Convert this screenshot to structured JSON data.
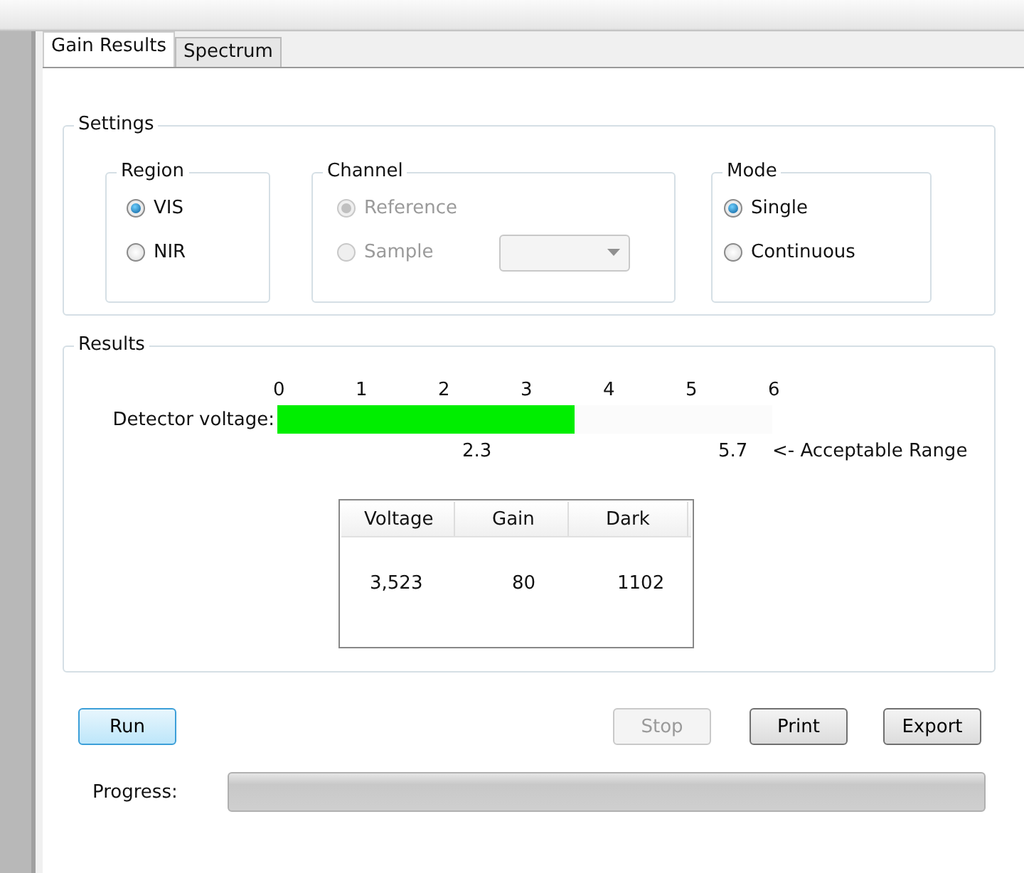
{
  "tabs": [
    {
      "label": "Gain Results",
      "selected": true
    },
    {
      "label": "Spectrum",
      "selected": false
    }
  ],
  "settings": {
    "title": "Settings",
    "groups": [
      {
        "title": "Region",
        "kind": "radios",
        "options": [
          {
            "label": "VIS",
            "selected": true,
            "disabled": false
          },
          {
            "label": "NIR",
            "selected": false,
            "disabled": false
          }
        ]
      },
      {
        "title": "Channel",
        "kind": "radios-combo",
        "options": [
          {
            "label": "Reference",
            "selected": true,
            "disabled": true
          },
          {
            "label": "Sample",
            "selected": false,
            "disabled": true
          }
        ],
        "combo": {
          "disabled": true
        }
      },
      {
        "title": "Mode",
        "kind": "radios",
        "options": [
          {
            "label": "Single",
            "selected": true,
            "disabled": false
          },
          {
            "label": "Continuous",
            "selected": false,
            "disabled": false
          }
        ]
      }
    ]
  },
  "results": {
    "title": "Results",
    "scale": [
      "0",
      "1",
      "2",
      "3",
      "4",
      "5",
      "6"
    ],
    "meter_label": "Detector voltage:",
    "level": 0.6,
    "range_low": "2.3",
    "range_high": "5.7",
    "range_note": "<- Acceptable Range",
    "table": {
      "columns": [
        "Voltage",
        "Gain",
        "Dark"
      ],
      "rows": [
        [
          "3,523",
          "80",
          "1102"
        ]
      ]
    }
  },
  "buttons": [
    {
      "label": "Run",
      "kind": "primary",
      "disabled": false
    },
    {
      "label": "Stop",
      "kind": "normal",
      "disabled": true
    },
    {
      "label": "Print",
      "kind": "normal",
      "disabled": false
    },
    {
      "label": "Export",
      "kind": "normal",
      "disabled": false
    }
  ],
  "progress": {
    "label": "Progress:",
    "level": 0
  }
}
